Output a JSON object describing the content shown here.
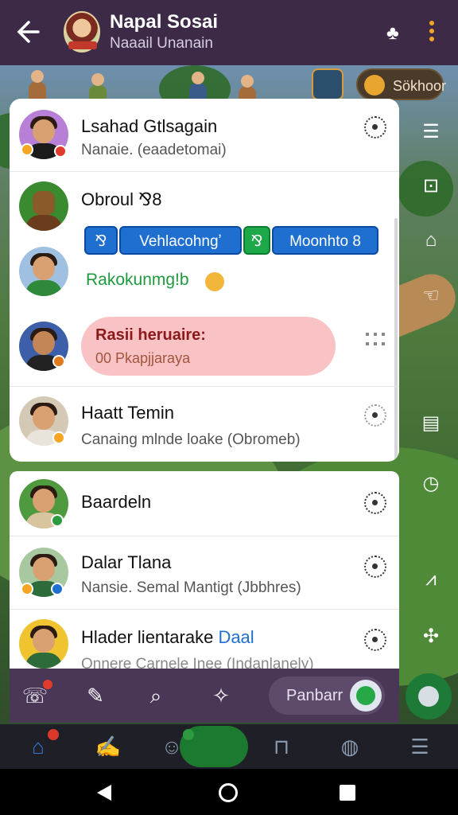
{
  "header": {
    "title": "Napal Sosai",
    "subtitle": "Naaail Unanain"
  },
  "game_overlay": {
    "score_label": "Sökhoor"
  },
  "chats_primary": [
    {
      "name": "Lsahad Gtlsagain",
      "message": "Nanaie. (eaadetomai)"
    },
    {
      "name": "Obroul  ⅋8",
      "chips": [
        "⅋",
        "Vehlacohngʼ",
        "⅋",
        "Moonhto 8"
      ],
      "green_text": "Rakokunmg!b"
    },
    {
      "bubble_title": "Rasii heruaire:",
      "bubble_sub": "00 Pkapjjaraya"
    },
    {
      "name": "Haatt Temin",
      "message": "Canaing mlnde loake (Obromeb)"
    }
  ],
  "chats_secondary": [
    {
      "name": "Baardeln",
      "message": ""
    },
    {
      "name": "Dalar Tlana",
      "message": "Nansie. Semal Mantigt (Jbbhres)"
    },
    {
      "name": "Hlader lientarake",
      "name_accent": "Daal",
      "message": "Onnere Carnele Inee (Indanlanely)"
    }
  ],
  "toolbar": {
    "pill_label": "Panbarr"
  },
  "colors": {
    "header_bg": "#3c2a47",
    "chip_blue": "#1f6fd1",
    "chip_green": "#1da84a",
    "bubble_pink": "#f9c3c6",
    "nav_active": "#1b7a2f"
  }
}
